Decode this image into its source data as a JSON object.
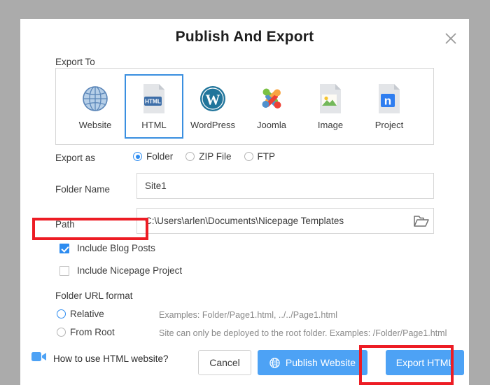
{
  "dialog": {
    "title": "Publish And Export",
    "close_icon": "close-x-icon"
  },
  "export_to": {
    "label": "Export To",
    "options": [
      {
        "label": "Website",
        "icon": "globe-icon",
        "selected": false
      },
      {
        "label": "HTML",
        "icon": "html-file-icon",
        "selected": true
      },
      {
        "label": "WordPress",
        "icon": "wordpress-icon",
        "selected": false
      },
      {
        "label": "Joomla",
        "icon": "joomla-icon",
        "selected": false
      },
      {
        "label": "Image",
        "icon": "image-file-icon",
        "selected": false
      },
      {
        "label": "Project",
        "icon": "project-file-icon",
        "selected": false
      }
    ]
  },
  "export_as": {
    "label": "Export as",
    "options": [
      {
        "label": "Folder",
        "selected": true
      },
      {
        "label": "ZIP File",
        "selected": false
      },
      {
        "label": "FTP",
        "selected": false
      }
    ]
  },
  "folder_name": {
    "label": "Folder Name",
    "value": "Site1",
    "placeholder": ""
  },
  "path": {
    "label": "Path",
    "value": "C:\\Users\\arlen\\Documents\\Nicepage Templates",
    "placeholder": "",
    "browse_icon": "open-folder-icon"
  },
  "checkboxes": [
    {
      "label": "Include Blog Posts",
      "checked": true
    },
    {
      "label": "Include Nicepage Project",
      "checked": false
    }
  ],
  "url_format": {
    "label": "Folder URL format",
    "options": [
      {
        "label": "Relative",
        "selected": true,
        "example": "Examples: Folder/Page1.html, ../../Page1.html"
      },
      {
        "label": "From Root",
        "selected": false,
        "example": "Site can only be deployed to the root folder.   Examples: /Folder/Page1.html"
      }
    ]
  },
  "footer": {
    "howto_label": "How to use HTML website?",
    "howto_icon": "video-camera-icon",
    "cancel_label": "Cancel",
    "publish_label": "Publish Website",
    "publish_icon": "globe-small-icon",
    "export_label": "Export HTML"
  },
  "colors": {
    "backdrop": "#ababab",
    "accent_blue": "#2d8cf0",
    "button_blue": "#4da2f5",
    "selection_border": "#3a8fe0",
    "annotation_red": "#ed1c24",
    "panel_border": "#d6d6d6"
  }
}
